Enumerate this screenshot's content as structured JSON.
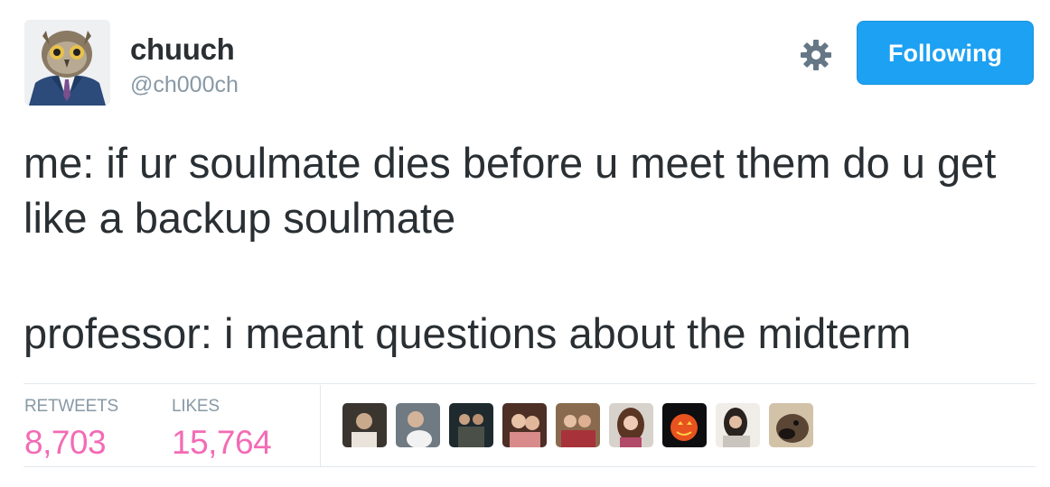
{
  "user": {
    "display_name": "chuuch",
    "handle": "@ch000ch"
  },
  "actions": {
    "follow_label": "Following",
    "settings_icon": "gear-icon"
  },
  "tweet": {
    "line1": "me: if ur soulmate dies before u meet them do u get like a backup soulmate",
    "line2": "professor: i meant questions about the midterm"
  },
  "stats": {
    "retweets_label": "RETWEETS",
    "retweets_value": "8,703",
    "likes_label": "LIKES",
    "likes_value": "15,764"
  },
  "colors": {
    "follow_button": "#1da1f2",
    "stat_value": "#f36bb6",
    "muted_text": "#8899a6",
    "main_text": "#292f33"
  }
}
